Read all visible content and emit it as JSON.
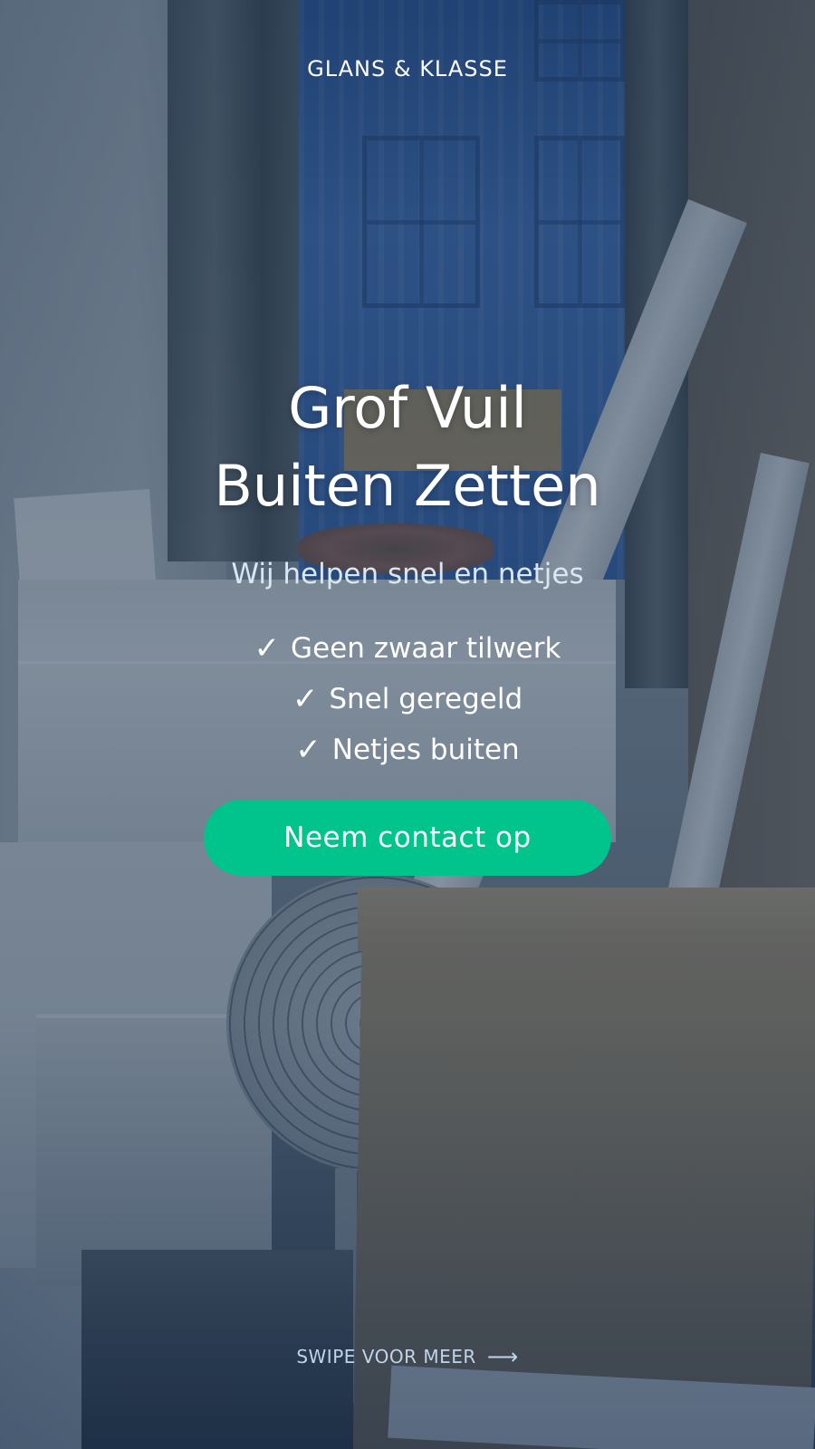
{
  "brand": {
    "name": "GLANS & KLASSE"
  },
  "hero": {
    "title_line1": "Grof Vuil",
    "title_line2": "Buiten Zetten",
    "subtitle": "Wij helpen snel en netjes"
  },
  "benefits": [
    {
      "icon": "checkmark-icon",
      "mark": "✓",
      "label": "Geen zwaar tilwerk"
    },
    {
      "icon": "checkmark-icon",
      "mark": "✓",
      "label": "Snel geregeld"
    },
    {
      "icon": "checkmark-icon",
      "mark": "✓",
      "label": "Netjes buiten"
    }
  ],
  "cta": {
    "label": "Neem contact op"
  },
  "footer": {
    "swipe_label": "SWIPE VOOR MEER",
    "arrow": "⟶"
  },
  "colors": {
    "accent": "#00c48c",
    "overlay": "#152c48",
    "subtitle_text": "#d9e6f3",
    "swipe_text": "#bfd3ea"
  }
}
